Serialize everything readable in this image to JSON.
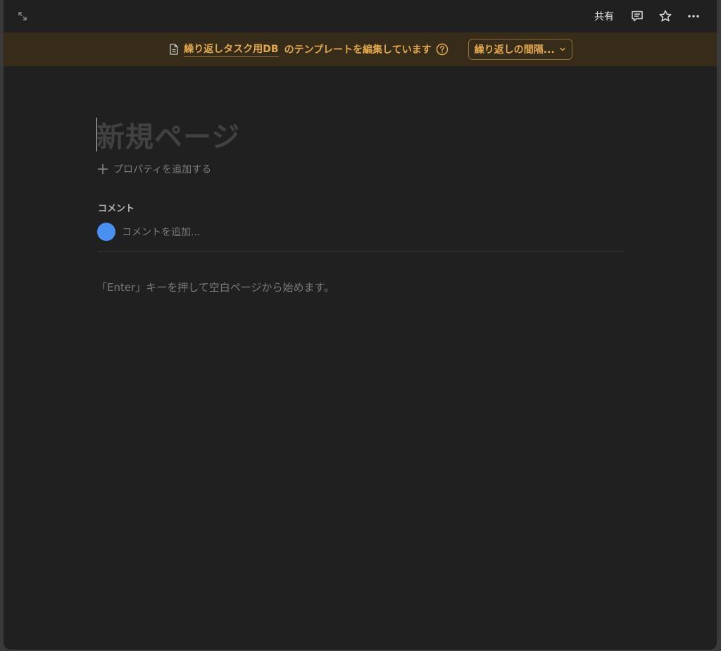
{
  "topbar": {
    "expand_icon": "expand-arrows-icon",
    "share_label": "共有",
    "comment_icon": "comment-icon",
    "star_icon": "star-icon",
    "more_icon": "more-horizontal-icon"
  },
  "banner": {
    "doc_icon": "document-icon",
    "db_link": "繰り返しタスク用DB",
    "text": "のテンプレートを編集しています",
    "help_icon": "question-circle-icon",
    "repeat_button": "繰り返しの間隔...",
    "colors": {
      "background": "#372b1a",
      "accent": "#e2a94e"
    }
  },
  "page": {
    "title_placeholder": "新規ページ",
    "add_property": "プロパティを追加する",
    "comments_heading": "コメント",
    "comment_placeholder": "コメントを追加...",
    "hint": "「Enter」キーを押して空白ページから始めます。"
  },
  "colors": {
    "background": "#202020",
    "avatar": "#4a90f0"
  }
}
